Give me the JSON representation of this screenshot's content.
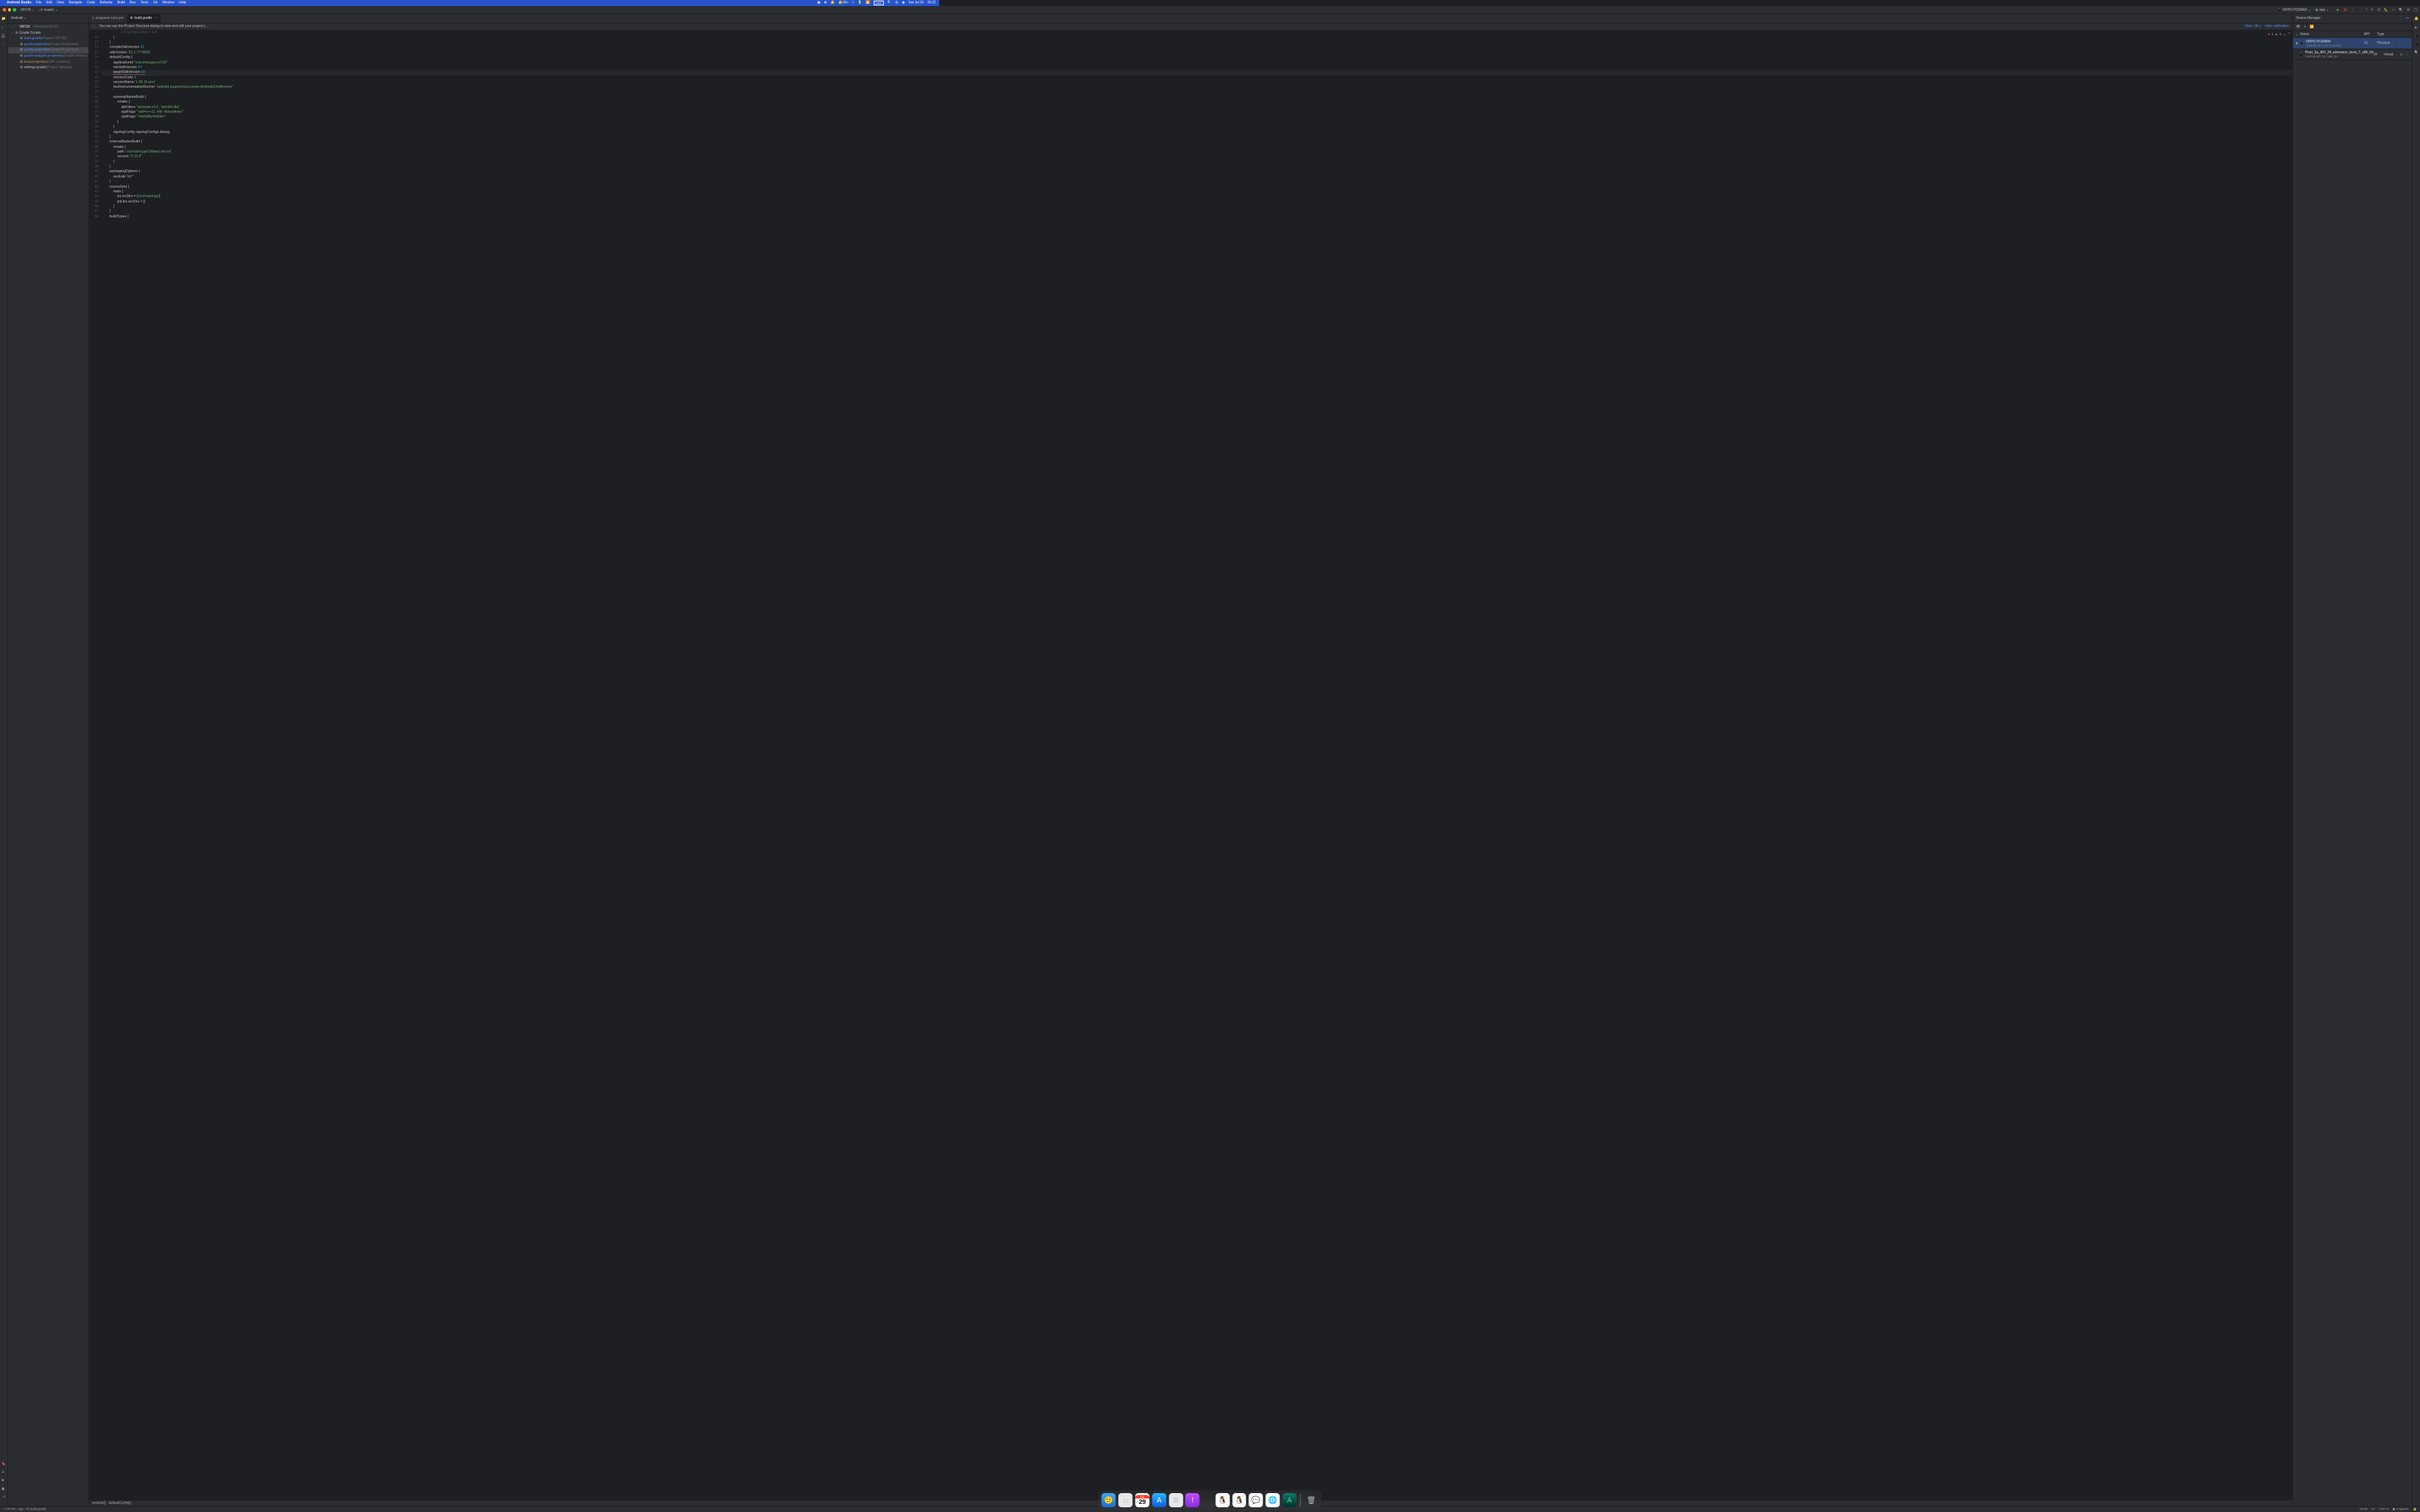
{
  "macbar": {
    "app": "Android Studio",
    "menus": [
      "File",
      "Edit",
      "View",
      "Navigate",
      "Code",
      "Refactor",
      "Build",
      "Run",
      "Tools",
      "Git",
      "Window",
      "Help"
    ],
    "notif_count": "99+",
    "input": "ABC",
    "date": "Sat Jul 29",
    "time": "20:22"
  },
  "toolbar": {
    "project": "VR720",
    "branch": "master",
    "device": "OPPO PCRM00",
    "config": "app"
  },
  "project_panel": {
    "title": "Android",
    "root": {
      "name": "VR720",
      "path": "~/Desktop/VR720"
    },
    "scripts_label": "Gradle Scripts",
    "files": [
      {
        "name": "build.gradle",
        "hint": "(Project: VR720)",
        "cls": "link"
      },
      {
        "name": "gradle.properties",
        "hint": "(Project Properties)",
        "cls": "link"
      },
      {
        "name": "gradle.properties",
        "hint": "(Global Properties)",
        "cls": "link",
        "sel": true
      },
      {
        "name": "gradle-wrapper.properties",
        "hint": "(Gradle Version)",
        "cls": "link"
      },
      {
        "name": "local.properties",
        "hint": "(SDK Location)",
        "cls": "warn"
      },
      {
        "name": "settings.gradle",
        "hint": "(Project Settings)",
        "cls": ""
      }
    ]
  },
  "tabs": [
    {
      "label": "proguard-rules.pro",
      "active": false
    },
    {
      "label": "build.gradle",
      "active": true
    }
  ],
  "notification": {
    "text": "You can use the Project Structure dialog to view and edit your project c…",
    "open": "Open (⌘;)",
    "hide": "Hide notification"
  },
  "inspect": {
    "errors": "1",
    "warnings": "3"
  },
  "code_lines": [
    {
      "n": "",
      "h": "                    v2SigningEnabled  true",
      "dim": true
    },
    {
      "n": "12",
      "h": "            }"
    },
    {
      "n": "13",
      "h": "        }"
    },
    {
      "n": "14",
      "h": "        compileSdkVersion <span class='c-num'>31</span>"
    },
    {
      "n": "15",
      "h": "        ndkVersion <span class='c-str'>'23.1.7779620'</span>"
    },
    {
      "n": "16",
      "h": "        defaultConfig <span class='c-txt'>{</span>"
    },
    {
      "n": "17",
      "h": "            applicationId <span class='c-str'>\"com.imengyu.vr720\"</span>"
    },
    {
      "n": "18",
      "h": "            minSdkVersion <span class='c-num'>23</span>"
    },
    {
      "n": "19",
      "h": "            <span class='underline'>targetSdkVersion</span> <span class='c-num underline'>30</span>",
      "hl": true
    },
    {
      "n": "20",
      "h": "            versionCode <span class='c-num'>6</span>"
    },
    {
      "n": "21",
      "h": "            versionName <span class='c-str'>'1.36.16-arm'</span>"
    },
    {
      "n": "22",
      "h": "            testInstrumentationRunner <span class='c-str'>\"android.support.test.runner.AndroidJUnitRunner\"</span>"
    },
    {
      "n": "23",
      "h": ""
    },
    {
      "n": "24",
      "h": "            externalNativeBuild <span class='c-txt'>{</span>"
    },
    {
      "n": "25",
      "h": "                cmake <span class='c-txt'>{</span>"
    },
    {
      "n": "26",
      "h": "                    abiFilters <span class='c-str'>\"armeabi-v7a\"</span>, <span class='c-str'>\"arm64-v8a\"</span>"
    },
    {
      "n": "27",
      "h": "                    cppFlags <span class='c-str'>\"-std=c++11 -frtti -fexceptions\"</span>"
    },
    {
      "n": "28",
      "h": "                    cppFlags <span class='c-str'>\"-fvisibility=hidden\"</span>"
    },
    {
      "n": "29",
      "h": "                }"
    },
    {
      "n": "30",
      "h": "            }"
    },
    {
      "n": "31",
      "h": "            signingConfig signingConfigs.debug"
    },
    {
      "n": "32",
      "h": "        }"
    },
    {
      "n": "33",
      "h": "        externalNativeBuild <span class='c-txt'>{</span>"
    },
    {
      "n": "34",
      "h": "            cmake <span class='c-txt'>{</span>"
    },
    {
      "n": "35",
      "h": "                path <span class='c-str'>\"src/main/cpp/CMakeLists.txt\"</span>"
    },
    {
      "n": "36",
      "h": "                version <span class='c-str'>\"3.10.2\"</span>"
    },
    {
      "n": "37",
      "h": "            }"
    },
    {
      "n": "38",
      "h": "        }"
    },
    {
      "n": "39",
      "h": "        packagingOptions <span class='c-txt'>{</span>"
    },
    {
      "n": "40",
      "h": "            exclude <span class='c-str'>'lib/*'</span>"
    },
    {
      "n": "41",
      "h": "        }"
    },
    {
      "n": "42",
      "h": "        sourceSets <span class='c-txt'>{</span>"
    },
    {
      "n": "43",
      "h": "            main <span class='c-txt'>{</span>"
    },
    {
      "n": "44",
      "h": "                jni.srcDirs = [<span class='c-str'>'src/main/cpp'</span>]"
    },
    {
      "n": "45",
      "h": "                jniLibs.srcDirs = []"
    },
    {
      "n": "46",
      "h": "            }"
    },
    {
      "n": "47",
      "h": "        }"
    },
    {
      "n": "48",
      "h": "        buildTypes <span class='c-txt'>{</span>"
    }
  ],
  "breadcrumb": [
    "android{}",
    "defaultConfig{}"
  ],
  "devmgr": {
    "title": "Device Manager",
    "cols": {
      "name": "Name",
      "api": "API",
      "type": "Type"
    },
    "devices": [
      {
        "name": "OPPO PCRM00",
        "sub": "Android 12.0 (\"S\") | arm64",
        "api": "31",
        "type": "Physical",
        "running": true,
        "sel": true
      },
      {
        "name": "Pixel_3a_API_34_extension_level_7_x86_64",
        "sub": "Android API 34 | x86_64",
        "api": "34",
        "type": "Virtual",
        "play": true
      }
    ]
  },
  "statusbar": {
    "path": [
      "VR720",
      "app",
      "build.gradle"
    ],
    "pos": "19:28",
    "le": "LF",
    "enc": "UTF-8",
    "indent": "4 spaces"
  },
  "dock": {
    "calendar": {
      "month": "JUL",
      "day": "29"
    }
  }
}
